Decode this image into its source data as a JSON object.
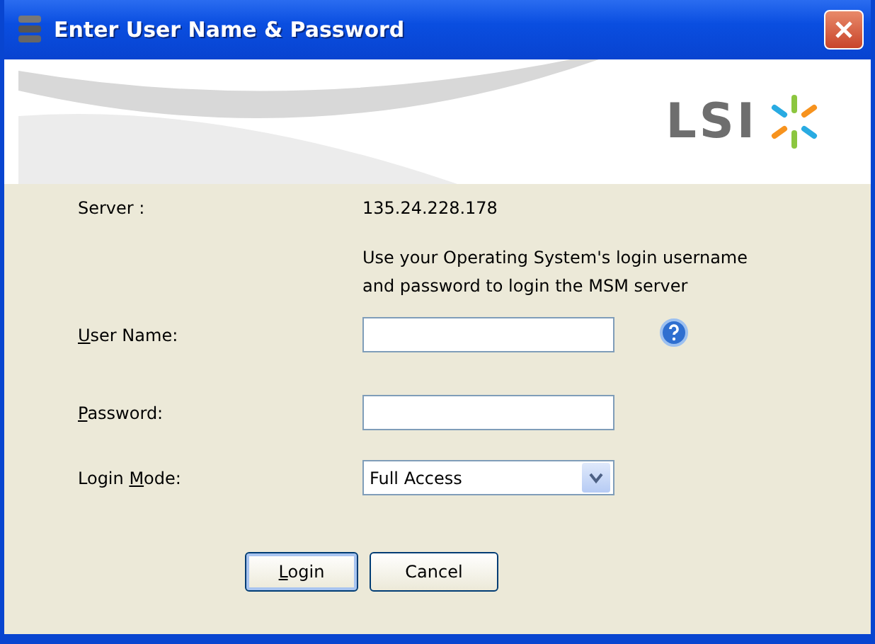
{
  "window": {
    "title": "Enter User Name & Password"
  },
  "banner": {
    "logo_text": "LSI"
  },
  "server": {
    "label": "Server :",
    "value": "135.24.228.178"
  },
  "note": [
    "Use your Operating System's login username",
    "and password to login the MSM server"
  ],
  "fields": [
    {
      "kind": "text",
      "access_key": "U",
      "label_after": "ser Name:",
      "help": true
    },
    {
      "kind": "password",
      "access_key": "P",
      "label_after": "assword:",
      "help": false
    },
    {
      "kind": "select",
      "label_before": "Login ",
      "access_key": "M",
      "label_after": "ode:",
      "value": "Full Access",
      "help": false
    }
  ],
  "buttons": [
    {
      "access_key": "L",
      "label_after": "ogin",
      "default": true
    },
    {
      "label_after": "Cancel",
      "default": false
    }
  ]
}
